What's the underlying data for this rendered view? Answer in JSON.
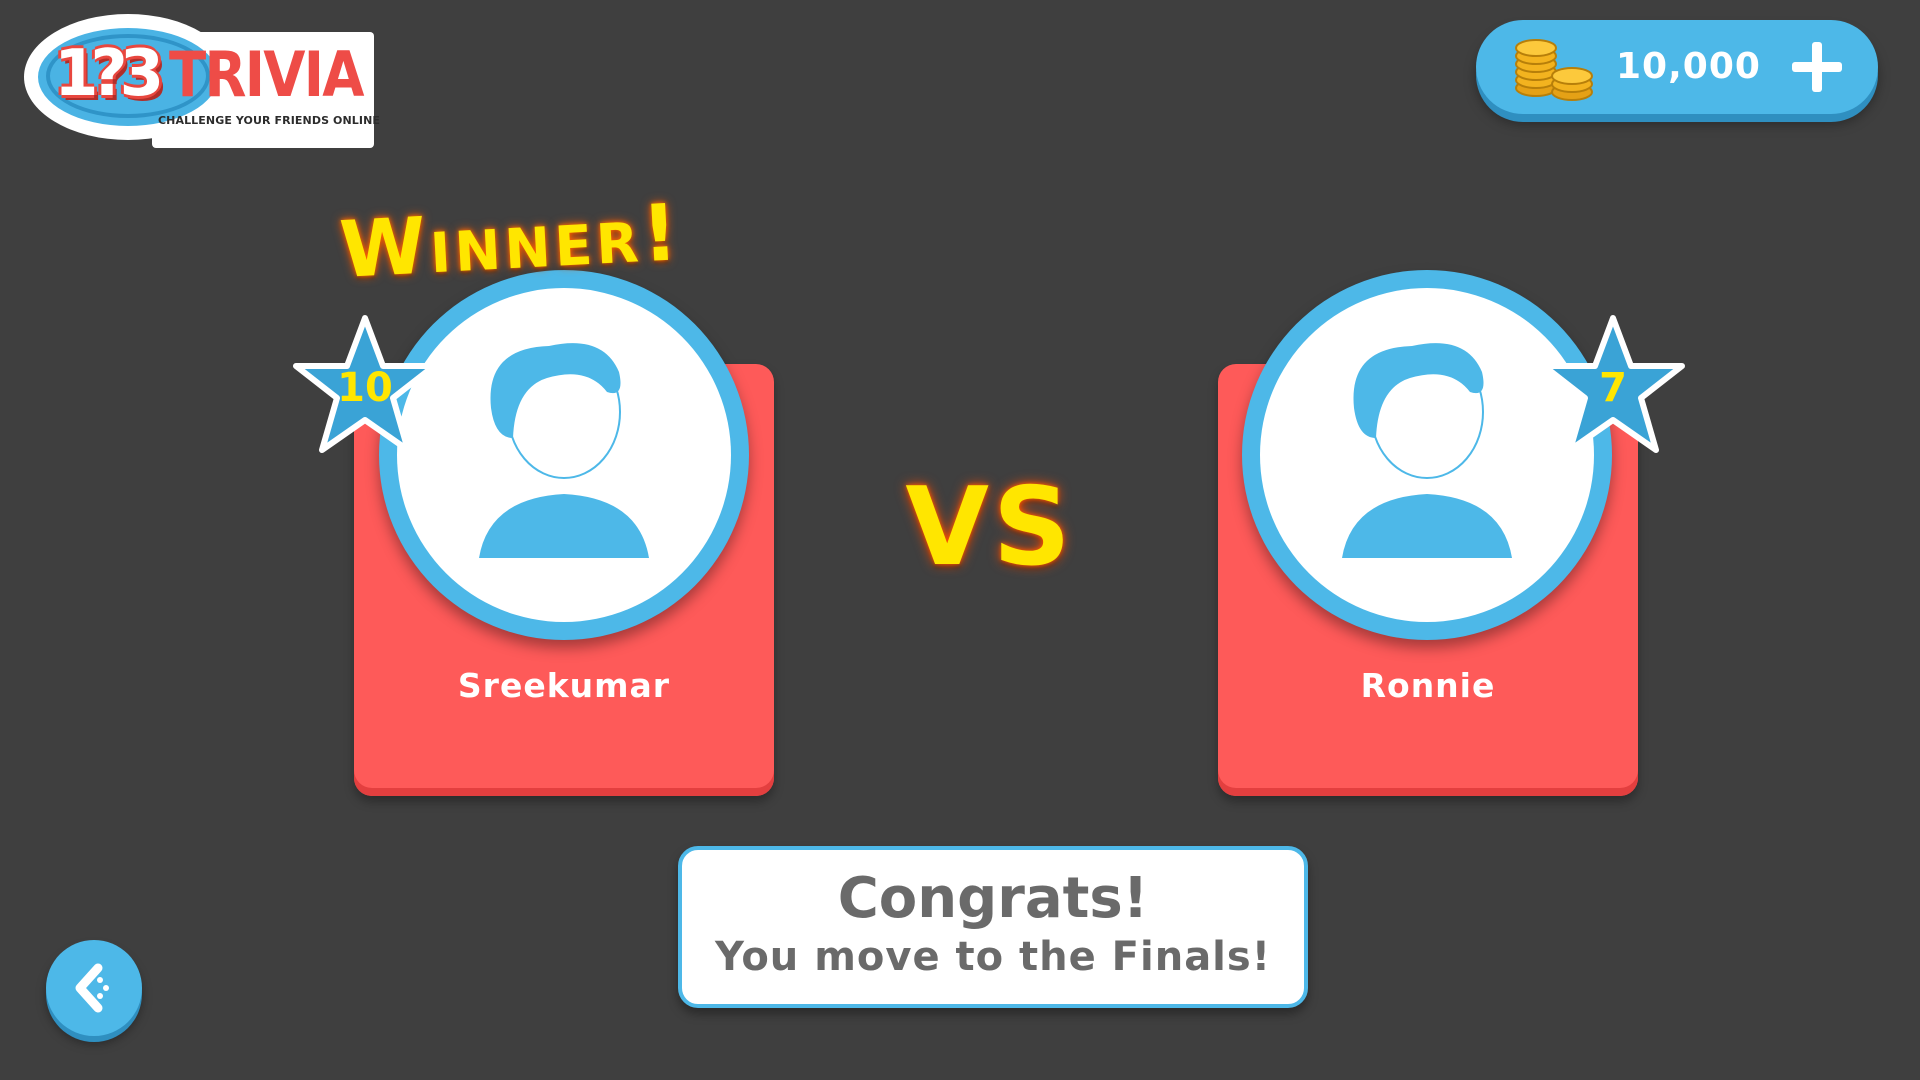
{
  "logo": {
    "digits": "1?3",
    "word": "TRIVIA",
    "tagline": "CHALLENGE YOUR FRIENDS ONLINE"
  },
  "coins": {
    "amount": "10,000",
    "icon": "coin-stack-icon",
    "add_icon": "plus-icon"
  },
  "result": {
    "winner_label": "Winner!",
    "vs_label": "VS"
  },
  "players": [
    {
      "name": "Sreekumar",
      "score": "10",
      "avatar_icon": "user-avatar-icon",
      "winner": true
    },
    {
      "name": "Ronnie",
      "score": "7",
      "avatar_icon": "user-avatar-icon",
      "winner": false
    }
  ],
  "message": {
    "title": "Congrats!",
    "subtitle": "You move to the Finals!"
  },
  "navigation": {
    "back_icon": "back-arrow-icon"
  },
  "colors": {
    "background": "#3f3f3f",
    "accent_blue": "#4db8e8",
    "card_red": "#fe5a59",
    "highlight_yellow": "#ffe600",
    "text_gray": "#6a6a6a"
  }
}
